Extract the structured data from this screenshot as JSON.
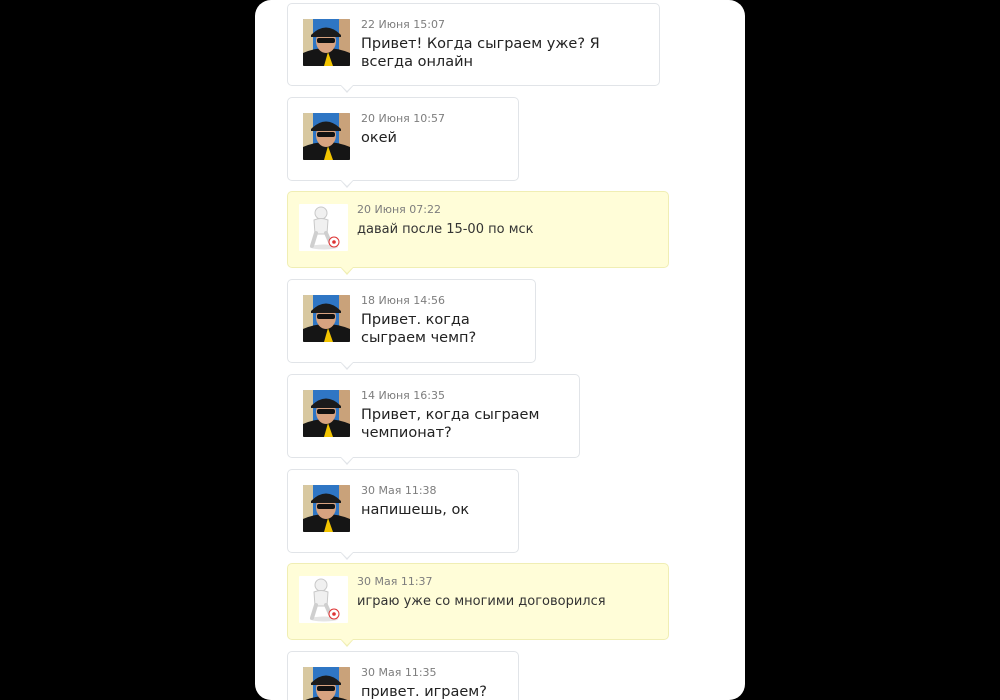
{
  "messages": [
    {
      "sender": "me",
      "time": "22 Июня 15:07",
      "text": "Привет! Когда сыграем уже? Я всегда онлайн"
    },
    {
      "sender": "me",
      "time": "20 Июня 10:57",
      "text": "окей"
    },
    {
      "sender": "other",
      "time": "20 Июня 07:22",
      "text": "давай после 15-00 по мск"
    },
    {
      "sender": "me",
      "time": "18 Июня 14:56",
      "text": "Привет. когда сыграем чемп?"
    },
    {
      "sender": "me",
      "time": "14 Июня 16:35",
      "text": "Привет, когда сыграем чемпионат?"
    },
    {
      "sender": "me",
      "time": "30 Мая 11:38",
      "text": "напишешь, ок"
    },
    {
      "sender": "other",
      "time": "30 Мая 11:37",
      "text": "играю уже со многими договорился"
    },
    {
      "sender": "me",
      "time": "30 Мая 11:35",
      "text": "привет. играем?"
    }
  ]
}
